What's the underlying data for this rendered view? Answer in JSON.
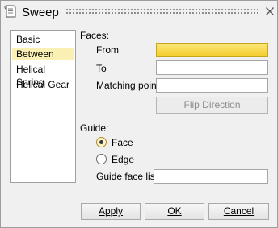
{
  "window": {
    "title": "Sweep",
    "icon": "sweep-doc-icon",
    "close_icon": "close-icon"
  },
  "categories": [
    {
      "label": "Basic",
      "selected": false
    },
    {
      "label": "Between",
      "selected": true
    },
    {
      "label": "Helical Spring",
      "selected": false
    },
    {
      "label": "Helical Gear",
      "selected": false
    }
  ],
  "faces": {
    "heading": "Faces:",
    "from_label": "From",
    "from_value": "",
    "to_label": "To",
    "to_value": "",
    "matching_label": "Matching point",
    "matching_value": "",
    "flip_label": "Flip Direction"
  },
  "guide": {
    "heading": "Guide:",
    "face_label": "Face",
    "edge_label": "Edge",
    "selected": "Face",
    "list_label": "Guide face list",
    "list_value": ""
  },
  "buttons": {
    "apply": "Apply",
    "ok": "OK",
    "cancel": "Cancel"
  },
  "colors": {
    "selection": "#fbf0b4",
    "active_field": "#f9d84a"
  }
}
